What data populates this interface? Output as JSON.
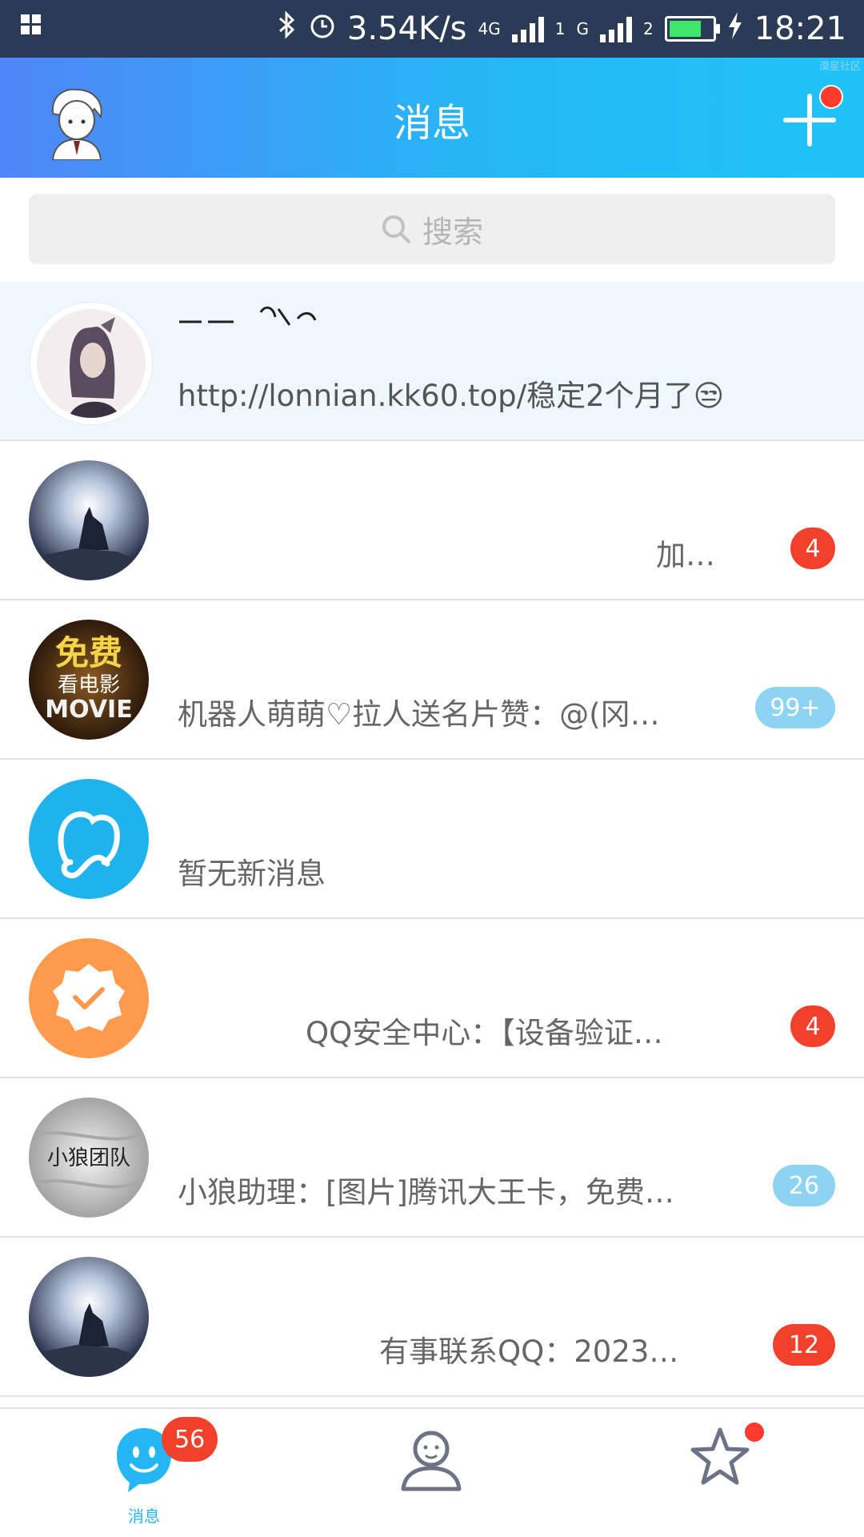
{
  "status_bar": {
    "net_speed": "3.54K/s",
    "net_type": "4G",
    "sim1": "1",
    "sim2_type": "G",
    "sim2": "2",
    "time": "18:21",
    "battery_level": 0.85
  },
  "header": {
    "title": "消息",
    "watermark": "漠星社区"
  },
  "search": {
    "placeholder": "搜索"
  },
  "conversations": [
    {
      "preview": "http://lonnian.kk60.top/稳定2个月了😒",
      "pinned": true
    },
    {
      "preview": "加…",
      "badge": "4",
      "badge_color": "#f2412b"
    },
    {
      "preview": "机器人萌萌♡拉人送名片赞：@(冈…",
      "badge": "99+",
      "badge_color": "#8dd3f2"
    },
    {
      "preview": "暂无新消息"
    },
    {
      "preview": "QQ安全中心：【设备验证…",
      "badge": "4",
      "badge_color": "#f2412b"
    },
    {
      "preview": "小狼助理：[图片]腾讯大王卡，免费…",
      "badge": "26",
      "badge_color": "#8dd3f2"
    },
    {
      "preview": "有事联系QQ：2023…",
      "badge": "12",
      "badge_color": "#f2412b"
    }
  ],
  "avatars": {
    "row3_text_top": "免费",
    "row3_text_mid": "看电影",
    "row3_text_bottom": "MOVIE",
    "row6_text": "小狼团队"
  },
  "tab_bar": {
    "messages_label": "消息",
    "messages_badge": "56",
    "accent": "#25b7f5"
  }
}
